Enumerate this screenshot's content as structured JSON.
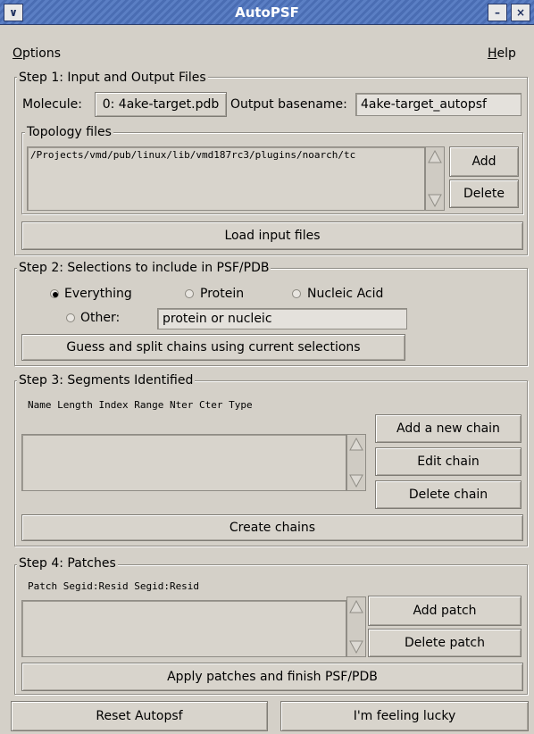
{
  "window": {
    "title": "AutoPSF"
  },
  "menu": {
    "options": "Options",
    "help": "Help"
  },
  "step1": {
    "legend": "Step 1: Input and Output Files",
    "molecule_label": "Molecule:",
    "molecule_value": "0: 4ake-target.pdb",
    "basename_label": "Output basename:",
    "basename_value": "4ake-target_autopsf",
    "topology_legend": "Topology files",
    "topology_items": [
      "/Projects/vmd/pub/linux/lib/vmd187rc3/plugins/noarch/tc"
    ],
    "add_label": "Add",
    "delete_label": "Delete",
    "load_label": "Load input files"
  },
  "step2": {
    "legend": "Step 2: Selections to include in PSF/PDB",
    "radio_everything": "Everything",
    "radio_protein": "Protein",
    "radio_nucleic": "Nucleic Acid",
    "radio_other": "Other:",
    "other_value": "protein or nucleic",
    "selected": "Everything",
    "guess_label": "Guess and split chains using current selections"
  },
  "step3": {
    "legend": "Step 3: Segments Identified",
    "columns": "Name Length  Index  Range Nter Cter Type",
    "add_chain": "Add a new chain",
    "edit_chain": "Edit chain",
    "delete_chain": "Delete chain",
    "create_chains": "Create chains"
  },
  "step4": {
    "legend": "Step 4: Patches",
    "columns": "Patch  Segid:Resid  Segid:Resid",
    "add_patch": "Add patch",
    "delete_patch": "Delete patch",
    "apply_label": "Apply patches and finish PSF/PDB"
  },
  "footer": {
    "reset_label": "Reset Autopsf",
    "lucky_label": "I'm feeling lucky"
  }
}
